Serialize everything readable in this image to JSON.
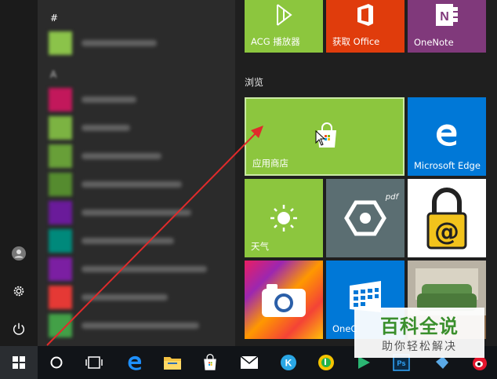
{
  "app_list": {
    "section_hash": "#",
    "section_a": "A",
    "items": [
      {
        "color": "#8bc34a",
        "w": 96
      },
      {
        "color": "#c2185b",
        "w": 70
      },
      {
        "color": "#7cb342",
        "w": 62
      },
      {
        "color": "#689f38",
        "w": 102
      },
      {
        "color": "#558b2f",
        "w": 128
      },
      {
        "color": "#6a1b9a",
        "w": 140
      },
      {
        "color": "#00897b",
        "w": 118
      },
      {
        "color": "#7b1fa2",
        "w": 160
      },
      {
        "color": "#e53935",
        "w": 110
      },
      {
        "color": "#43a047",
        "w": 150
      }
    ]
  },
  "tiles": {
    "acg_label": "ACG 播放器",
    "office_label": "获取 Office",
    "onenote_label": "OneNote",
    "group_label": "浏览",
    "store_label": "应用商店",
    "edge_label": "Microsoft Edge",
    "weather_label": "天气",
    "onecalendar_label": "OneC",
    "pdf_text": "pdf"
  },
  "watermark": {
    "title": "百科全说",
    "subtitle": "助你轻松解决"
  },
  "colors": {
    "green_tile": "#8cc63e",
    "office_tile": "#e03c0c",
    "onenote_tile": "#80397b",
    "edge_tile": "#0078d7",
    "arrow": "#e02b2b"
  }
}
